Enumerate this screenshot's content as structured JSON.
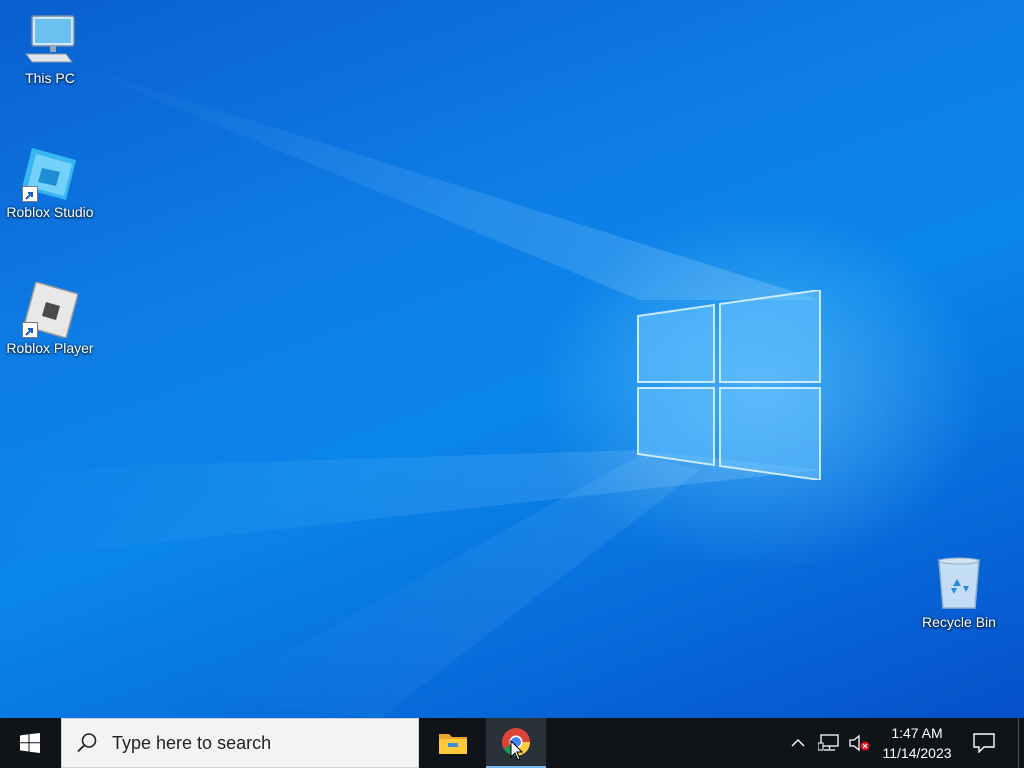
{
  "desktop": {
    "icons": [
      {
        "label": "This PC",
        "icon": "computer-icon"
      },
      {
        "label": "Roblox Studio",
        "icon": "roblox-studio-icon"
      },
      {
        "label": "Roblox Player",
        "icon": "roblox-player-icon"
      },
      {
        "label": "Recycle Bin",
        "icon": "recycle-bin-icon"
      }
    ]
  },
  "taskbar": {
    "start_icon": "windows-logo-icon",
    "search": {
      "placeholder": "Type here to search",
      "icon": "search-icon"
    },
    "pinned": [
      {
        "name": "File Explorer",
        "icon": "folder-icon",
        "active": false
      },
      {
        "name": "Google Chrome",
        "icon": "chrome-icon",
        "active": true
      }
    ],
    "tray": {
      "time": "1:47 AM",
      "date": "11/14/2023",
      "icons": [
        "chevron-up-icon",
        "network-icon",
        "volume-muted-icon",
        "notification-icon"
      ]
    }
  },
  "colors": {
    "wallpaper": "#0a78e3",
    "taskbar": "#101419",
    "accent": "#76b9ed"
  }
}
